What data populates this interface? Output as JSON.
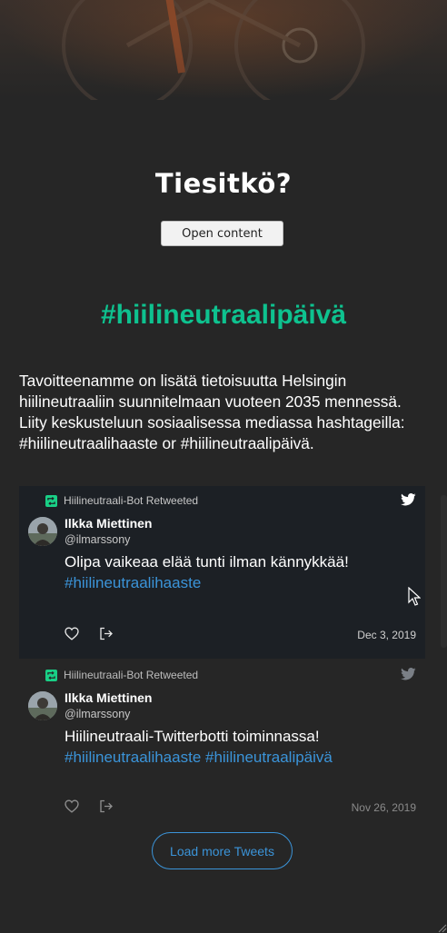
{
  "hero": {
    "image": "bicycle-photo"
  },
  "did_you_know": {
    "title": "Tiesitkö?",
    "button_label": "Open content"
  },
  "hashtag_section": {
    "title": "#hiilineutraalipäivä",
    "intro": "Tavoitteenamme on lisätä tietoisuutta Helsingin hiilineutraaliin suunnitelmaan vuoteen 2035 mennessä. Liity keskusteluun sosiaalisessa mediassa hashtageilla: #hiilineutraalihaaste or #hiilineutraalipäivä."
  },
  "timeline": {
    "tweets": [
      {
        "retweet_label": "Hiilineutraali-Bot Retweeted",
        "author_name": "Ilkka Miettinen",
        "author_handle": "@ilmarssony",
        "text": "Olipa vaikeaa elää tunti ilman kännykkää!",
        "hashtags": "#hiilineutraalihaaste",
        "date": "Dec 3, 2019"
      },
      {
        "retweet_label": "Hiilineutraali-Bot Retweeted",
        "author_name": "Ilkka Miettinen",
        "author_handle": "@ilmarssony",
        "text": "Hiilineutraali-Twitterbotti toiminnassa!",
        "hashtags": "#hiilineutraalihaaste #hiilineutraalipäivä",
        "date": "Nov 26, 2019"
      }
    ],
    "load_more_label": "Load more Tweets"
  },
  "colors": {
    "background": "#262626",
    "hashtag_green": "#0ec28f",
    "link_blue": "#3b94d9",
    "retweet_green": "#19cf86"
  }
}
